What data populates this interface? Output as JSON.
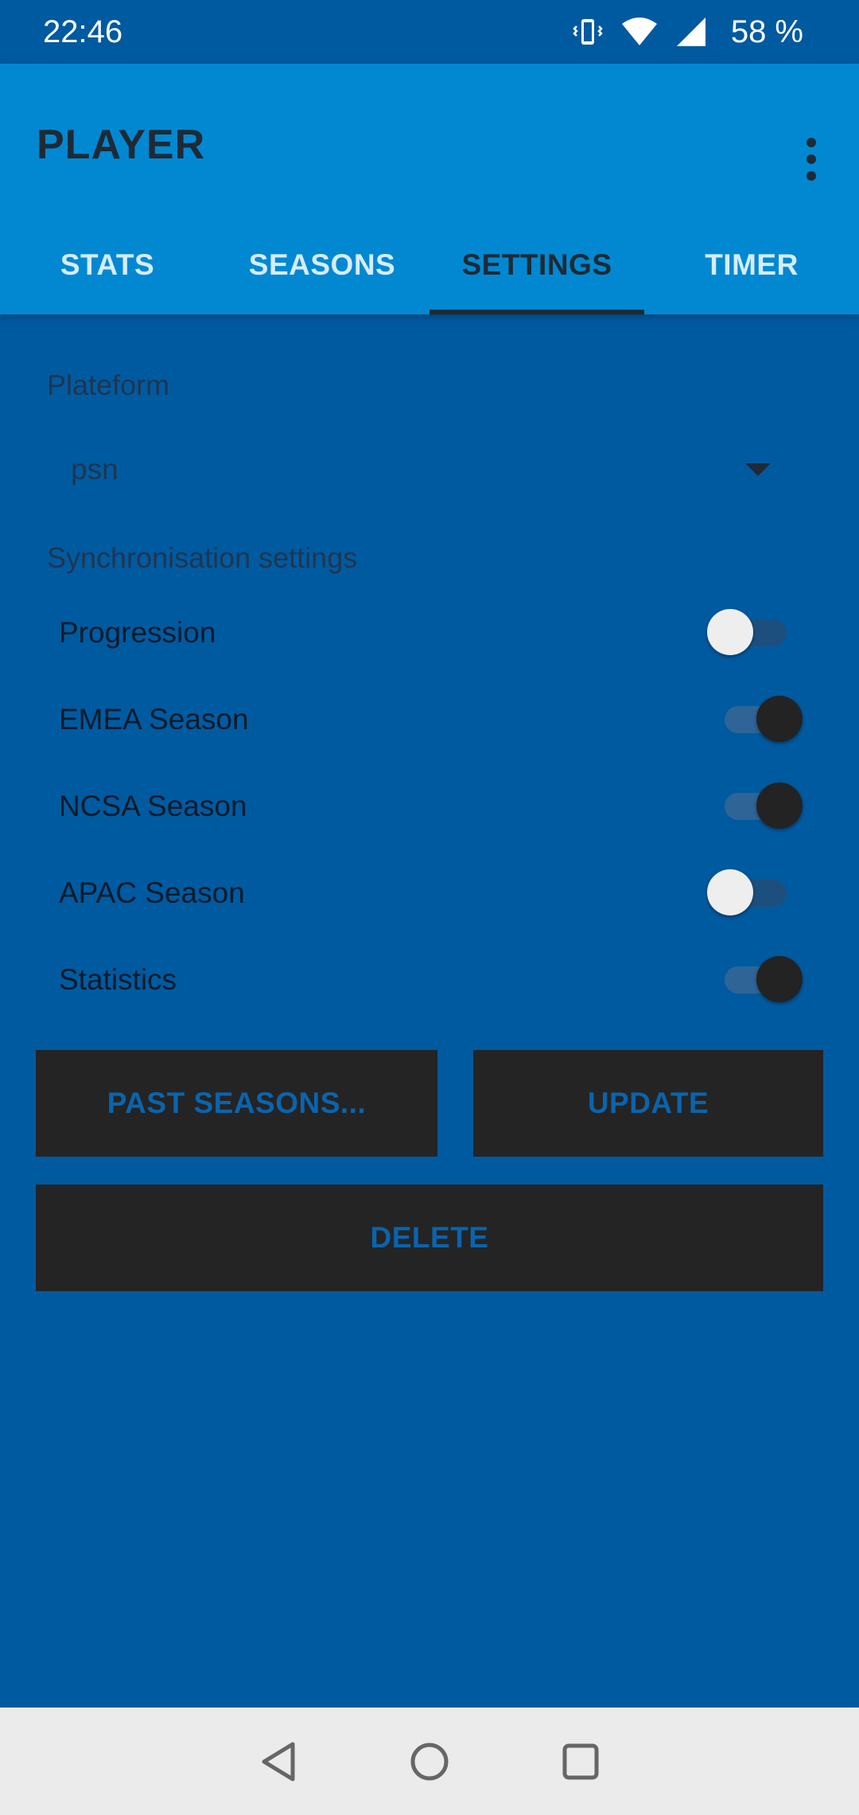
{
  "status_bar": {
    "time": "22:46",
    "battery": "58 %",
    "icons": [
      "vibrate-icon",
      "wifi-icon",
      "cell-signal-icon"
    ]
  },
  "app_bar": {
    "title": "PLAYER",
    "overflow_icon": "more-vert-icon"
  },
  "tabs": [
    {
      "label": "STATS",
      "active": false
    },
    {
      "label": "SEASONS",
      "active": false
    },
    {
      "label": "SETTINGS",
      "active": true
    },
    {
      "label": "TIMER",
      "active": false
    }
  ],
  "settings": {
    "platform_label": "Plateform",
    "platform_value": "psn",
    "sync_label": "Synchronisation settings",
    "toggles": [
      {
        "label": "Progression",
        "on": false
      },
      {
        "label": "EMEA Season",
        "on": true
      },
      {
        "label": "NCSA Season",
        "on": true
      },
      {
        "label": "APAC Season",
        "on": false
      },
      {
        "label": "Statistics",
        "on": true
      }
    ]
  },
  "buttons": {
    "past_seasons": "PAST SEASONS...",
    "update": "UPDATE",
    "delete": "DELETE"
  },
  "colors": {
    "background": "#005aa0",
    "app_bar": "#0288d1",
    "button": "#242424",
    "button_text": "#0a64ad"
  },
  "nav_bar": {
    "icons": [
      "back-icon",
      "home-icon",
      "recents-icon"
    ]
  }
}
